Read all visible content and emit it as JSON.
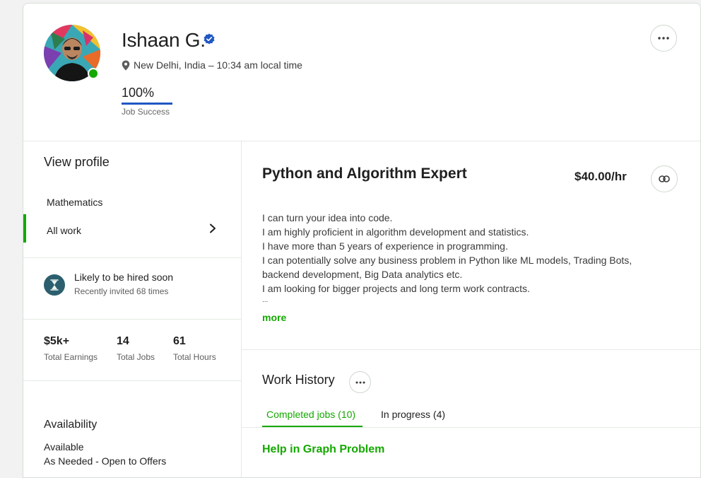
{
  "profile": {
    "name": "Ishaan G.",
    "location": "New Delhi, India – 10:34 am local time",
    "job_success_value": "100%",
    "job_success_percent": 100,
    "job_success_label": "Job Success"
  },
  "sidebar": {
    "view_profile": "View profile",
    "items": [
      {
        "label": "Mathematics"
      },
      {
        "label": "All work"
      }
    ],
    "hire": {
      "title": "Likely to be hired soon",
      "subtitle": "Recently invited 68 times"
    },
    "stats": [
      {
        "value": "$5k+",
        "label": "Total Earnings"
      },
      {
        "value": "14",
        "label": "Total Jobs"
      },
      {
        "value": "61",
        "label": "Total Hours"
      }
    ],
    "availability": {
      "title": "Availability",
      "status": "Available",
      "detail": "As Needed - Open to Offers"
    }
  },
  "main": {
    "title": "Python and Algorithm Expert",
    "rate": "$40.00/hr",
    "description": [
      "I can turn your idea into code.",
      "I am highly proficient in algorithm development and statistics.",
      "I have more than 5 years of experience in programming.",
      "I can potentially solve any business problem in Python like ML models, Trading Bots, backend development, Big Data analytics etc.",
      "I am looking for bigger projects and long term work contracts.",
      "..."
    ],
    "more_label": "more",
    "work_history": {
      "title": "Work History",
      "tabs": [
        {
          "label": "Completed jobs (10)",
          "active": true
        },
        {
          "label": "In progress (4)",
          "active": false
        }
      ],
      "jobs": [
        {
          "title": "Help in Graph Problem"
        }
      ]
    }
  },
  "icons": {
    "verified": "verified-badge-icon",
    "location": "location-pin-icon",
    "more": "ellipsis-icon",
    "link": "link-icon",
    "chevron": "chevron-right-icon",
    "hourglass": "hourglass-icon"
  },
  "colors": {
    "accent": "#14a800",
    "verified": "#1f57c3",
    "jss_bar": "#1f57c3",
    "hire_badge": "#2c5e6e"
  }
}
